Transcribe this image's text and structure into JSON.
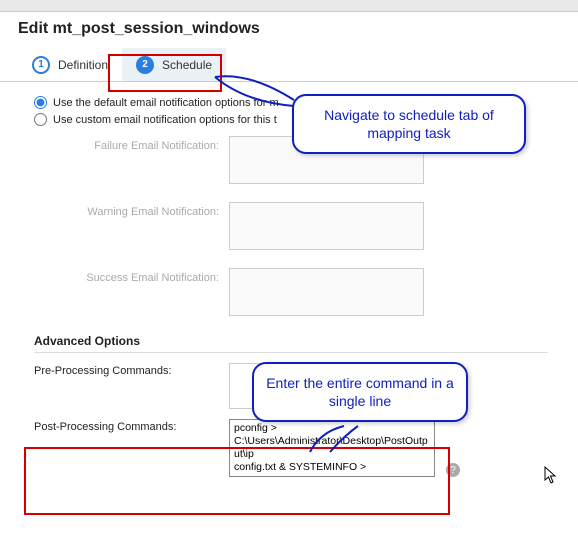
{
  "topstrip_text": "",
  "title": "Edit mt_post_session_windows",
  "tabs": {
    "definition": {
      "num": "1",
      "label": "Definition"
    },
    "schedule": {
      "num": "2",
      "label": "Schedule"
    }
  },
  "email": {
    "radio_default": "Use the default email notification options for m",
    "radio_custom": "Use custom email notification options for this t",
    "failure_label": "Failure Email Notification:",
    "warning_label": "Warning Email Notification:",
    "success_label": "Success Email Notification:",
    "failure_value": "",
    "warning_value": "",
    "success_value": ""
  },
  "advanced": {
    "heading": "Advanced Options",
    "pre_label": "Pre-Processing Commands:",
    "pre_value": "",
    "post_label": "Post-Processing Commands:",
    "post_value": "pconfig >\nC:\\Users\\Administrator\\Desktop\\PostOutput\\ip\nconfig.txt & SYSTEMINFO >\nC:\\Users\\Administrator\\Desktop\\PostOutput\\s"
  },
  "callouts": {
    "c1": "Navigate to schedule tab of mapping task",
    "c2": "Enter the entire command in a single line"
  },
  "help_glyph": "?"
}
